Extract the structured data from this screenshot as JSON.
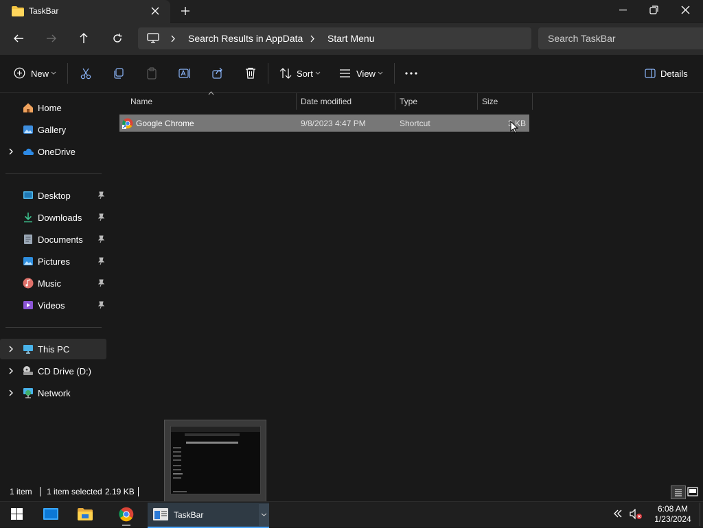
{
  "window": {
    "tab_title": "TaskBar",
    "new_tab_label": "+"
  },
  "address": {
    "breadcrumb": [
      "Search Results in AppData",
      "Start Menu"
    ],
    "search_placeholder": "Search TaskBar"
  },
  "toolbar": {
    "new_label": "New",
    "sort_label": "Sort",
    "view_label": "View",
    "details_label": "Details"
  },
  "sidebar": {
    "top": [
      {
        "label": "Home",
        "icon": "home-icon"
      },
      {
        "label": "Gallery",
        "icon": "gallery-icon"
      },
      {
        "label": "OneDrive",
        "icon": "onedrive-icon"
      }
    ],
    "quick_access": [
      {
        "label": "Desktop",
        "icon": "desktop-icon"
      },
      {
        "label": "Downloads",
        "icon": "downloads-icon"
      },
      {
        "label": "Documents",
        "icon": "documents-icon"
      },
      {
        "label": "Pictures",
        "icon": "pictures-icon"
      },
      {
        "label": "Music",
        "icon": "music-icon"
      },
      {
        "label": "Videos",
        "icon": "videos-icon"
      }
    ],
    "devices": [
      {
        "label": "This PC",
        "icon": "this-pc-icon"
      },
      {
        "label": "CD Drive (D:)",
        "icon": "cd-drive-icon"
      },
      {
        "label": "Network",
        "icon": "network-icon"
      }
    ]
  },
  "columns": {
    "name": "Name",
    "date": "Date modified",
    "type": "Type",
    "size": "Size"
  },
  "files": [
    {
      "name": "Google Chrome",
      "date": "9/8/2023 4:47 PM",
      "type": "Shortcut",
      "size": "3 KB"
    }
  ],
  "status": {
    "item_count": "1 item",
    "selection": "1 item selected",
    "selection_size": "2.19 KB"
  },
  "taskbar": {
    "active_task_label": "TaskBar",
    "time": "6:08 AM",
    "date": "1/23/2024"
  },
  "colors": {
    "accent": "#4aa6ff",
    "folder": "#f4c542",
    "selected_row": "#777777"
  }
}
